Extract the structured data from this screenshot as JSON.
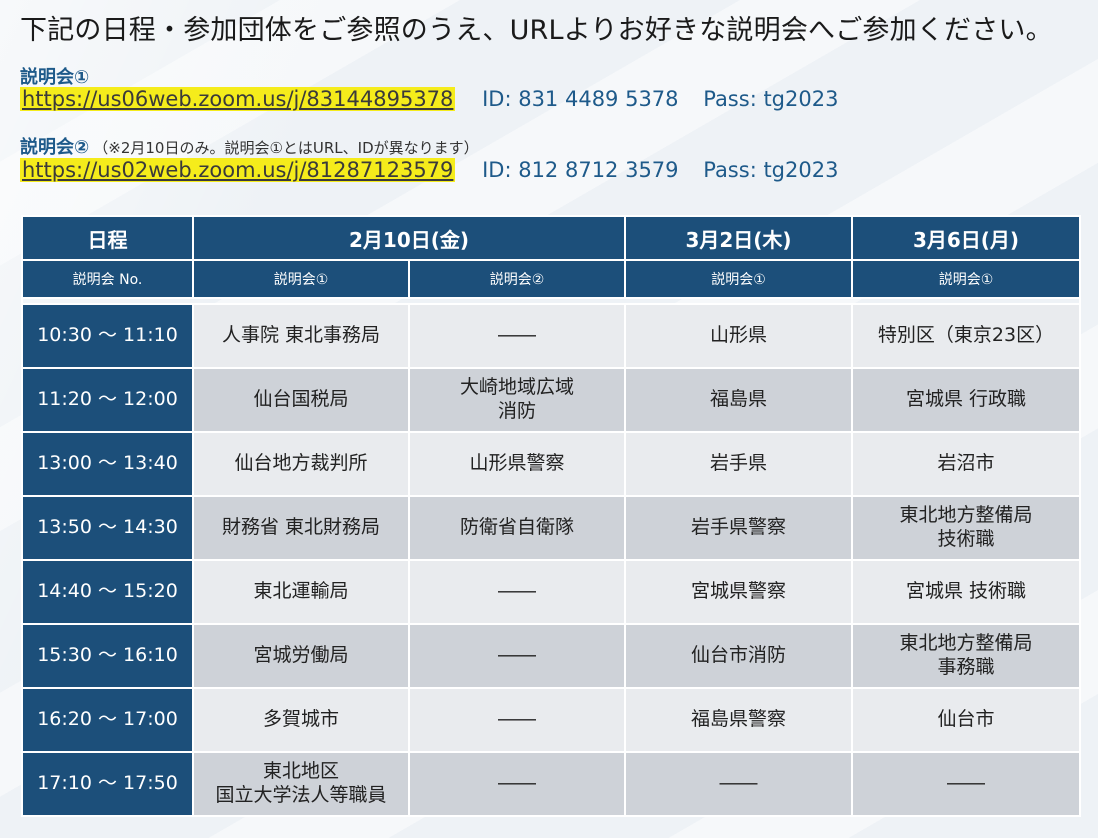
{
  "intro": "下記の日程・参加団体をご参照のうえ、URLよりお好きな説明会へご参加ください。",
  "sessions": [
    {
      "title": "説明会①",
      "note": "",
      "url": "https://us06web.zoom.us/j/83144895378",
      "id_text": "ID: 831 4489 5378",
      "pass_text": "Pass: tg2023"
    },
    {
      "title": "説明会②",
      "note": "（※2月10日のみ。説明会①とはURL、IDが異なります）",
      "url": "https://us02web.zoom.us/j/81287123579",
      "id_text": "ID: 812 8712 3579",
      "pass_text": "Pass: tg2023"
    }
  ],
  "table": {
    "header": {
      "schedule": "日程",
      "dates": [
        "2月10日(金)",
        "3月2日(木)",
        "3月6日(月)"
      ]
    },
    "subheader": {
      "label": "説明会 No.",
      "cols": [
        "説明会①",
        "説明会②",
        "説明会①",
        "説明会①"
      ]
    },
    "rows": [
      {
        "time": "10:30 ～ 11:10",
        "cells": [
          "人事院 東北事務局",
          "――",
          "山形県",
          "特別区（東京23区）"
        ]
      },
      {
        "time": "11:20 ～ 12:00",
        "cells": [
          "仙台国税局",
          "大崎地域広域\n消防",
          "福島県",
          "宮城県 行政職"
        ]
      },
      {
        "time": "13:00 ～ 13:40",
        "cells": [
          "仙台地方裁判所",
          "山形県警察",
          "岩手県",
          "岩沼市"
        ]
      },
      {
        "time": "13:50 ～ 14:30",
        "cells": [
          "財務省 東北財務局",
          "防衛省自衛隊",
          "岩手県警察",
          "東北地方整備局\n技術職"
        ]
      },
      {
        "time": "14:40 ～ 15:20",
        "cells": [
          "東北運輸局",
          "――",
          "宮城県警察",
          "宮城県 技術職"
        ]
      },
      {
        "time": "15:30 ～ 16:10",
        "cells": [
          "宮城労働局",
          "――",
          "仙台市消防",
          "東北地方整備局\n事務職"
        ]
      },
      {
        "time": "16:20 ～ 17:00",
        "cells": [
          "多賀城市",
          "――",
          "福島県警察",
          "仙台市"
        ]
      },
      {
        "time": "17:10 ～ 17:50",
        "cells": [
          "東北地区\n国立大学法人等職員",
          "――",
          "――",
          "――"
        ]
      }
    ]
  },
  "colors": {
    "header_bg": "#1c4f7a",
    "link_highlight": "#f5ec1b",
    "accent_text": "#1e5a8a"
  }
}
